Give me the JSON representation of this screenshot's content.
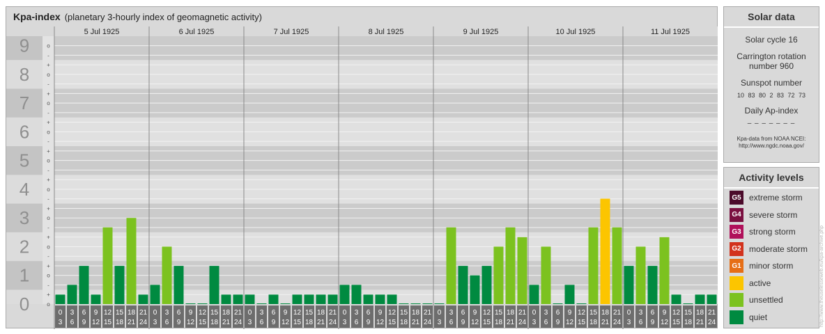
{
  "header": {
    "title": "Kpa-index",
    "subtitle": "(planetary 3-hourly index of geomagnetic activity)"
  },
  "chart_data": {
    "type": "bar",
    "days": [
      "5 Jul 1925",
      "6 Jul 1925",
      "7 Jul 1925",
      "8 Jul 1925",
      "9 Jul 1925",
      "10 Jul 1925",
      "11 Jul 1925"
    ],
    "interval_labels": [
      [
        "0",
        "3"
      ],
      [
        "3",
        "6"
      ],
      [
        "6",
        "9"
      ],
      [
        "9",
        "12"
      ],
      [
        "12",
        "15"
      ],
      [
        "15",
        "18"
      ],
      [
        "18",
        "21"
      ],
      [
        "21",
        "24"
      ]
    ],
    "y_ticks": [
      "0",
      "1",
      "2",
      "3",
      "4",
      "5",
      "6",
      "7",
      "8",
      "9"
    ],
    "ylim": [
      0,
      9.33
    ],
    "minor_ticks": [
      "-",
      "o",
      "+"
    ],
    "values": [
      0.33,
      0.67,
      1.33,
      0.33,
      2.67,
      1.33,
      3.0,
      0.33,
      0.67,
      2.0,
      1.33,
      0.0,
      0.0,
      1.33,
      0.33,
      0.33,
      0.33,
      0.0,
      0.33,
      0.0,
      0.33,
      0.33,
      0.33,
      0.33,
      0.67,
      0.67,
      0.33,
      0.33,
      0.33,
      0.0,
      0.0,
      0.0,
      0.0,
      2.67,
      1.33,
      1.0,
      1.33,
      2.0,
      2.67,
      2.33,
      0.67,
      2.0,
      0.0,
      0.67,
      0.0,
      2.67,
      3.67,
      2.67,
      1.33,
      2.0,
      1.33,
      2.33,
      0.33,
      0.0,
      0.33,
      0.33
    ],
    "colors": {
      "quiet": "#008a40",
      "unsettled": "#7cc21f",
      "active": "#fcc500"
    }
  },
  "solar": {
    "title": "Solar data",
    "cycle": "Solar cycle 16",
    "carrington_line1": "Carrington rotation",
    "carrington_line2": "number 960",
    "sunspot_title": "Sunspot number",
    "sunspot_values": "10 83 80 2 83 72 73",
    "ap_title": "Daily Ap-index",
    "ap_values": "– – – – – – –",
    "note_line1": "Kpa-data from NOAA NCEI:",
    "note_line2": "http://www.ngdc.noaa.gov/"
  },
  "activity": {
    "title": "Activity levels",
    "levels": [
      {
        "code": "G5",
        "label": "extreme storm",
        "color": "#4b0a2a"
      },
      {
        "code": "G4",
        "label": "severe storm",
        "color": "#7a1040"
      },
      {
        "code": "G3",
        "label": "strong storm",
        "color": "#b0105a"
      },
      {
        "code": "G2",
        "label": "moderate storm",
        "color": "#d2321c"
      },
      {
        "code": "G1",
        "label": "minor storm",
        "color": "#e66e16"
      },
      {
        "code": "",
        "label": "active",
        "color": "#fcc500"
      },
      {
        "code": "",
        "label": "unsettled",
        "color": "#7cc21f"
      },
      {
        "code": "",
        "label": "quiet",
        "color": "#008a40"
      }
    ]
  },
  "watermark": "http://www.theuselesseweb.eu/kpa-archive.php"
}
